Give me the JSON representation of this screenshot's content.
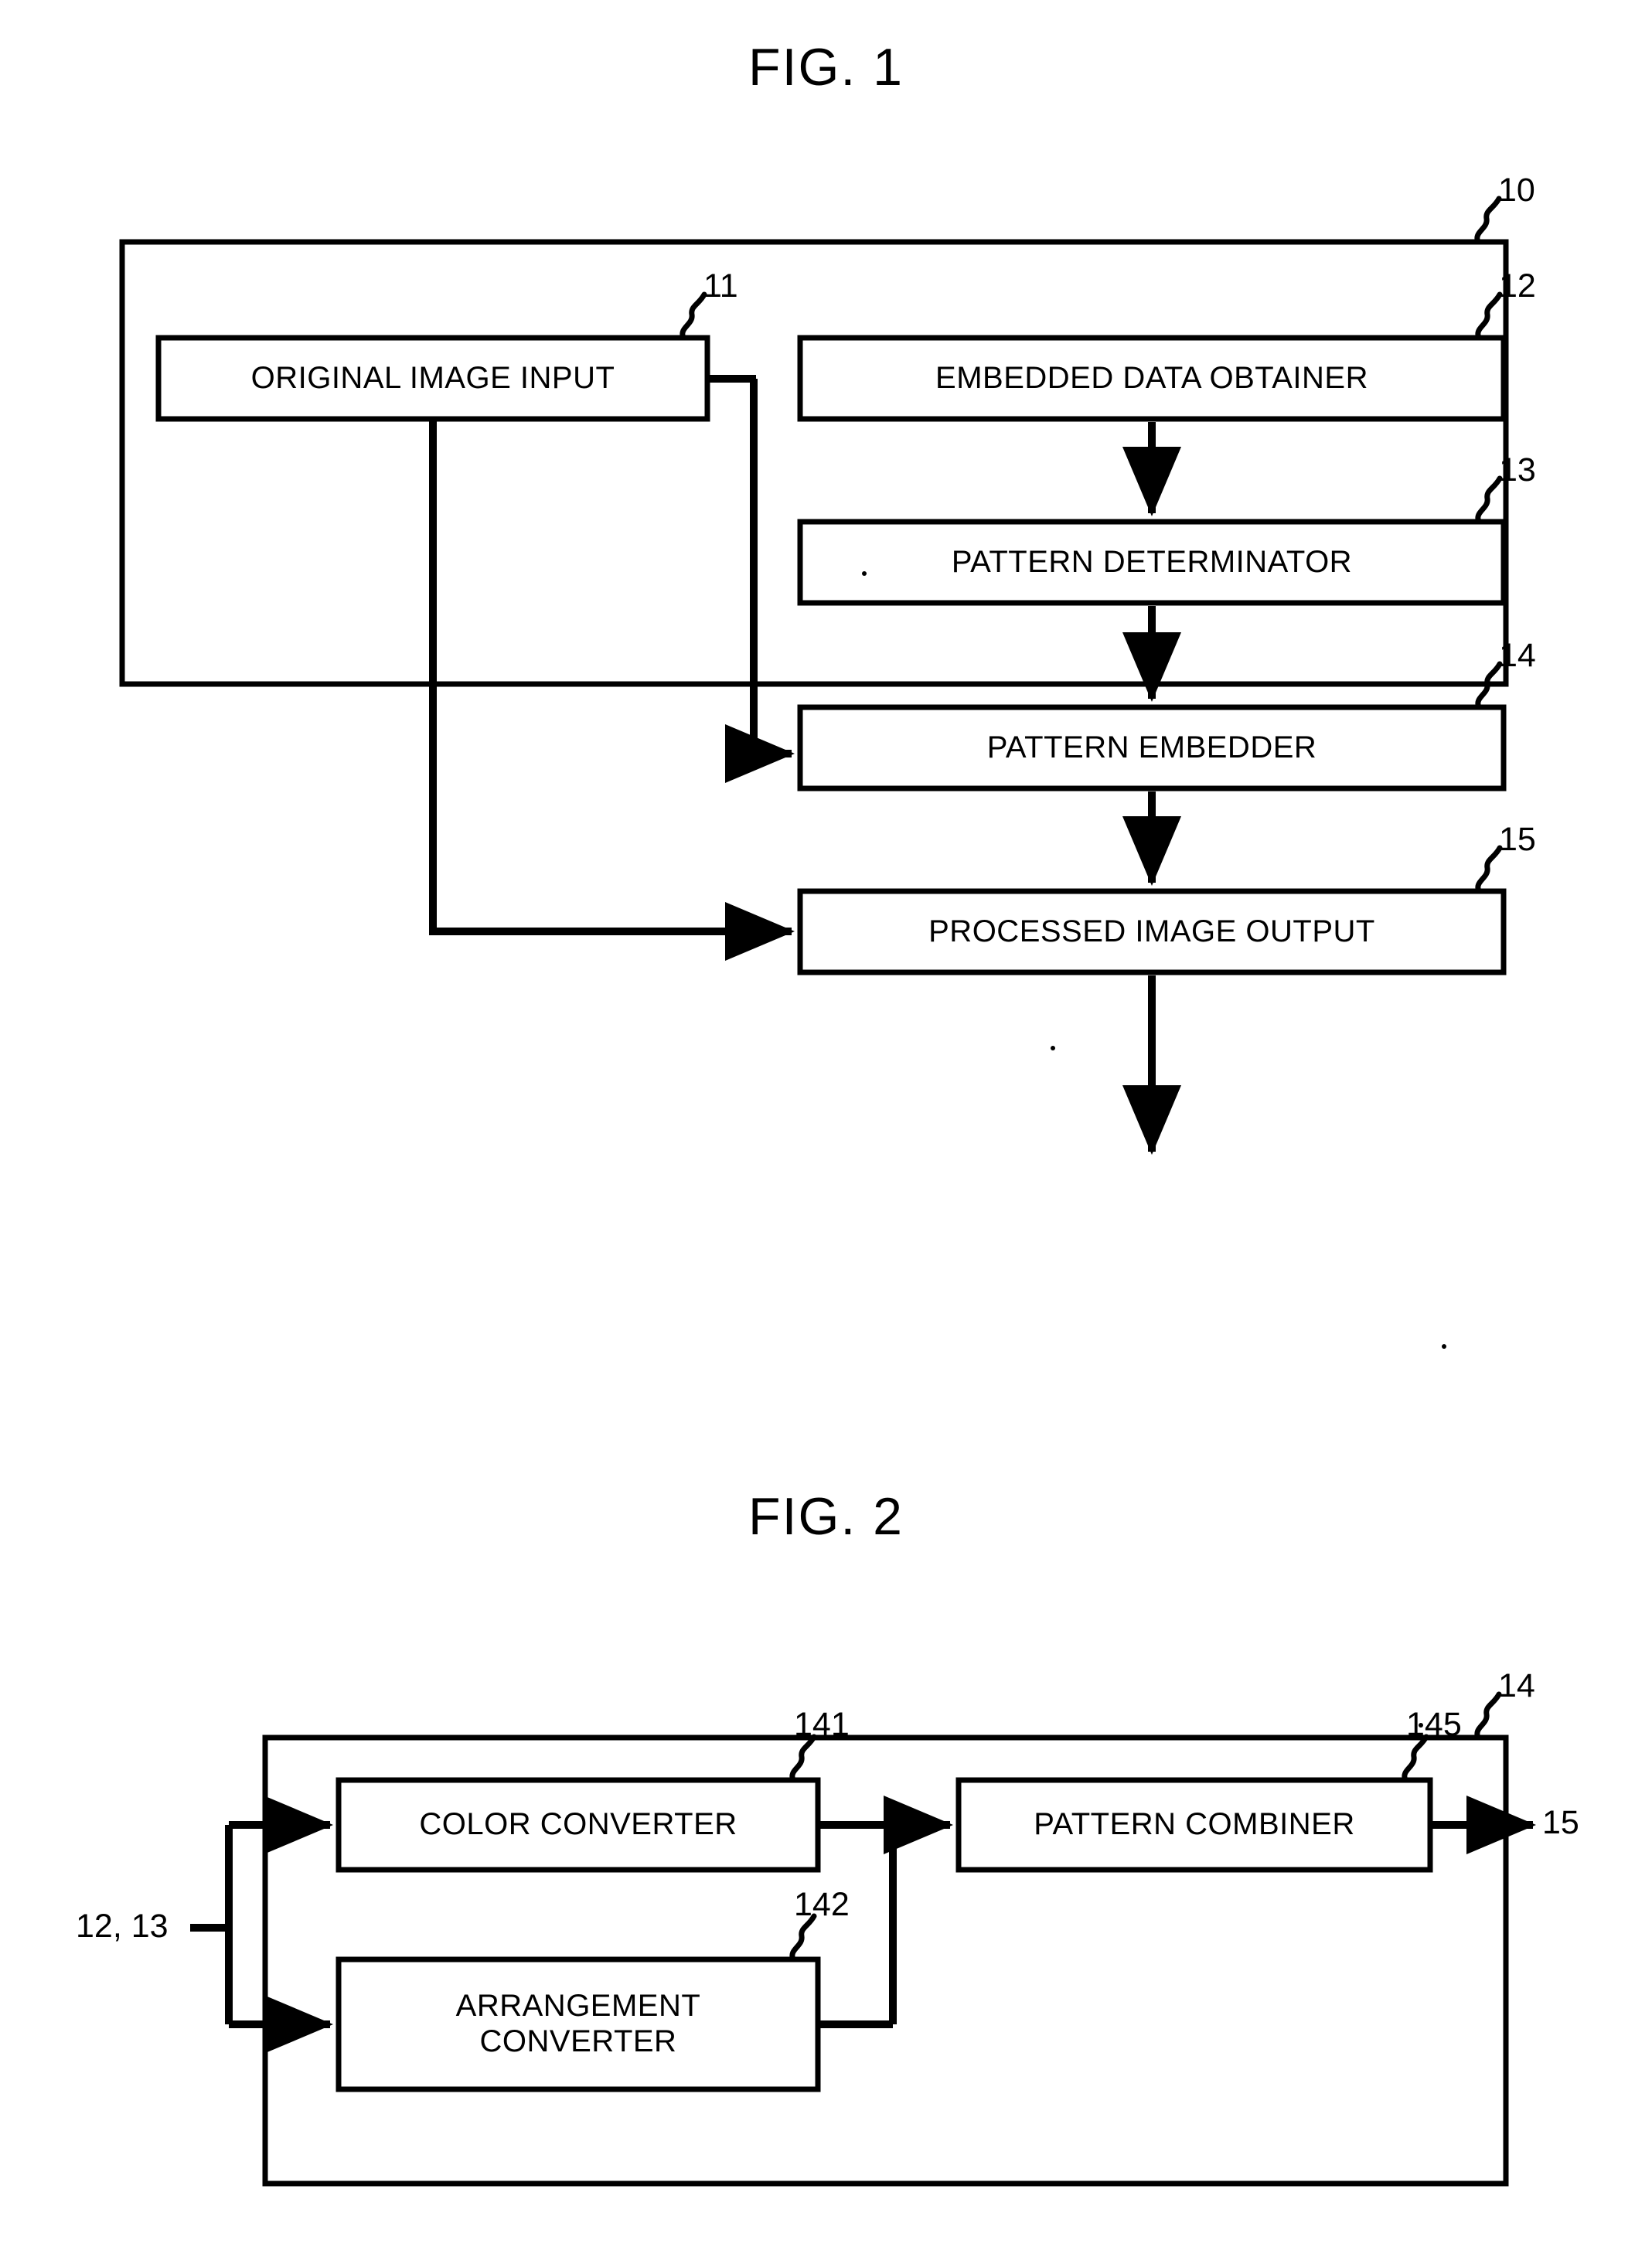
{
  "document": {
    "type": "patent-drawing-sheet",
    "background": "#ffffff",
    "ink": "#000000"
  },
  "figures": [
    {
      "id": "fig1",
      "title": "FIG. 1",
      "outer_ref": "10",
      "blocks": [
        {
          "ref": "11",
          "label": "ORIGINAL IMAGE INPUT"
        },
        {
          "ref": "12",
          "label": "EMBEDDED DATA OBTAINER"
        },
        {
          "ref": "13",
          "label": "PATTERN DETERMINATOR"
        },
        {
          "ref": "14",
          "label": "PATTERN EMBEDDER"
        },
        {
          "ref": "15",
          "label": "PROCESSED IMAGE OUTPUT"
        }
      ]
    },
    {
      "id": "fig2",
      "title": "FIG. 2",
      "outer_ref": "14",
      "input_label": "12, 13",
      "output_label": "15",
      "blocks": [
        {
          "ref": "141",
          "label": "COLOR CONVERTER"
        },
        {
          "ref": "142",
          "label": "ARRANGEMENT\nCONVERTER"
        },
        {
          "ref": "145",
          "label": "PATTERN COMBINER"
        }
      ]
    }
  ],
  "fig1": {
    "title": "FIG. 1",
    "ref_10": "10",
    "ref_11": "11",
    "ref_12": "12",
    "ref_13": "13",
    "ref_14": "14",
    "ref_15": "15",
    "block_11": "ORIGINAL IMAGE INPUT",
    "block_12": "EMBEDDED DATA OBTAINER",
    "block_13": "PATTERN DETERMINATOR",
    "block_14": "PATTERN EMBEDDER",
    "block_15": "PROCESSED IMAGE OUTPUT"
  },
  "fig2": {
    "title": "FIG. 2",
    "ref_14": "14",
    "ref_141": "141",
    "ref_142": "142",
    "ref_145": "145",
    "input_ref": "12, 13",
    "output_ref": "15",
    "block_141": "COLOR CONVERTER",
    "block_142": "ARRANGEMENT\nCONVERTER",
    "block_145": "PATTERN COMBINER"
  }
}
